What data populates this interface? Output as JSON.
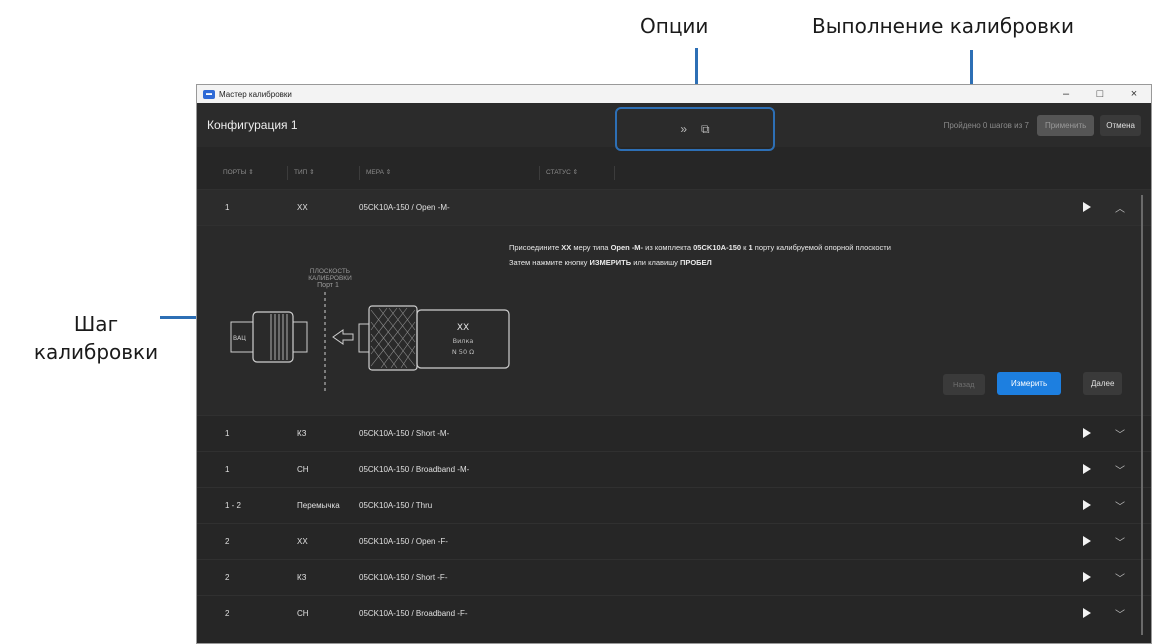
{
  "annotations": {
    "options": "Опции",
    "execution": "Выполнение калибровки",
    "step_line1": "Шаг",
    "step_line2": "калибровки"
  },
  "window": {
    "title": "Мастер калибровки",
    "controls": {
      "minimize": "–",
      "maximize": "□",
      "close": "×"
    }
  },
  "header": {
    "config_title": "Конфигурация 1",
    "options_expand": "»",
    "options_open": "⧉",
    "progress": "Пройдено 0 шагов из 7",
    "apply_label": "Применить",
    "cancel_label": "Отмена"
  },
  "columns": [
    "ПОРТЫ ⇕",
    "ТИП ⇕",
    "МЕРА ⇕",
    "СТАТУС ⇕"
  ],
  "first_row": {
    "port": "1",
    "type": "XX",
    "mera": "05CK10A-150 / Open -M-"
  },
  "step": {
    "line1_pre": "Присоедините ",
    "line1_std": "XX",
    "line1_mid": " меру типа ",
    "line1_type": "Open -M-",
    "line1_mid2": " из комплекта ",
    "line1_kit": "05CK10A-150",
    "line1_mid3": " к ",
    "line1_port": "1",
    "line1_end": " порту калибруемой опорной плоскости",
    "line2_pre": "Затем нажмите кнопку ",
    "line2_btn": "ИЗМЕРИТЬ",
    "line2_mid": " или клавишу ",
    "line2_key": "ПРОБЕЛ",
    "plane_label": "ПЛОСКОСТЬ КАЛИБРОВКИ",
    "port_label": "Порт 1",
    "vna_label": "ВАЦ",
    "connector_label": "XX",
    "connector_sub1": "Вилка",
    "connector_sub2": "N 50 Ω",
    "back_label": "Назад",
    "measure_label": "Измерить",
    "next_label": "Далее"
  },
  "rows": [
    {
      "port": "1",
      "type": "КЗ",
      "mera": "05CK10A-150 / Short -M-"
    },
    {
      "port": "1",
      "type": "CH",
      "mera": "05CK10A-150 / Broadband -M-"
    },
    {
      "port": "1 - 2",
      "type": "Перемычка",
      "mera": "05CK10A-150 / Thru"
    },
    {
      "port": "2",
      "type": "XX",
      "mera": "05CK10A-150 / Open -F-"
    },
    {
      "port": "2",
      "type": "КЗ",
      "mera": "05CK10A-150 / Short -F-"
    },
    {
      "port": "2",
      "type": "CH",
      "mera": "05CK10A-150 / Broadband -F-"
    }
  ],
  "colors": {
    "accent": "#1d7fe0",
    "annotation": "#2d6fb5"
  }
}
